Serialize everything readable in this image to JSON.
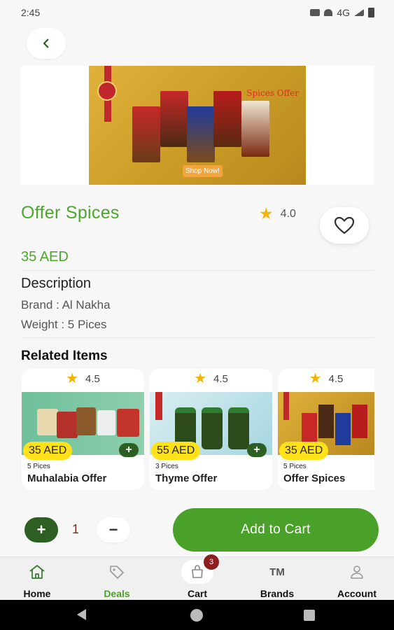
{
  "status": {
    "time": "2:45",
    "network": "4G"
  },
  "banner": {
    "title": "Spices Offer",
    "cta": "Shop Now!"
  },
  "product": {
    "title": "Offer Spices",
    "rating": "4.0",
    "price": "35 AED",
    "description_title": "Description",
    "brand_line": "Brand  : Al Nakha",
    "weight_line": "Weight  : 5 Pices"
  },
  "related": {
    "title": "Related Items",
    "items": [
      {
        "rating": "4.5",
        "price": "35 AED",
        "qty": "5 Pices",
        "name": "Muhalabia Offer"
      },
      {
        "rating": "4.5",
        "price": "55 AED",
        "qty": "3 Pices",
        "name": "Thyme Offer"
      },
      {
        "rating": "4.5",
        "price": "35 AED",
        "qty": "5 Pices",
        "name": "Offer Spices"
      }
    ]
  },
  "quantity": {
    "value": "1",
    "plus": "+",
    "minus": "−"
  },
  "add_to_cart": "Add to Cart",
  "nav": {
    "items": [
      {
        "label": "Home",
        "icon": "home-icon"
      },
      {
        "label": "Deals",
        "icon": "tag-icon",
        "active": true
      },
      {
        "label": "Cart",
        "icon": "cart-icon",
        "badge": "3"
      },
      {
        "label": "Brands",
        "icon": "tm-icon",
        "icon_text": "TM"
      },
      {
        "label": "Account",
        "icon": "user-icon"
      }
    ]
  },
  "colors": {
    "brand_green": "#4aa12a",
    "dark_green": "#2d5f22",
    "star": "#f4b400",
    "price_pill": "#ffe21a",
    "badge": "#8b1f1f"
  }
}
